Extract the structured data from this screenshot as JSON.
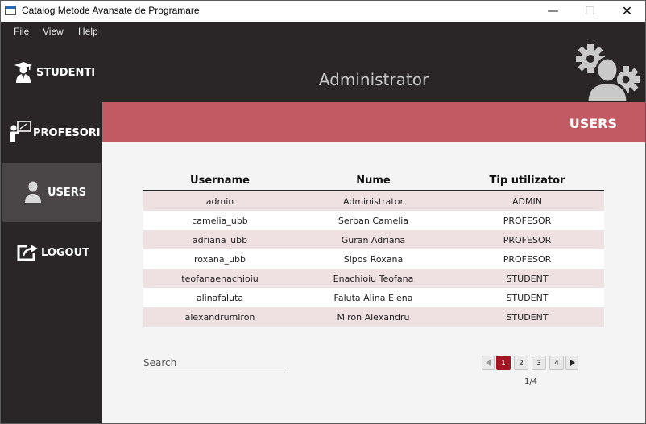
{
  "window": {
    "title": "Catalog Metode Avansate de Programare",
    "minimize_glyph": "—",
    "maximize_glyph": "☐",
    "close_glyph": "✕"
  },
  "menu": [
    "File",
    "View",
    "Help"
  ],
  "sidebar": {
    "items": [
      {
        "label": "STUDENTI",
        "icon": "graduate-icon"
      },
      {
        "label": "PROFESORI",
        "icon": "teacher-board-icon"
      },
      {
        "label": "USERS",
        "icon": "user-icon",
        "active": true
      },
      {
        "label": "LOGOUT",
        "icon": "logout-icon"
      }
    ]
  },
  "header": {
    "title": "Administrator",
    "icon": "admin-gear-user-icon"
  },
  "banner": {
    "title": "USERS"
  },
  "table": {
    "columns": [
      "Username",
      "Nume",
      "Tip utilizator"
    ],
    "rows": [
      [
        "admin",
        "Administrator",
        "ADMIN"
      ],
      [
        "camelia_ubb",
        "Serban Camelia",
        "PROFESOR"
      ],
      [
        "adriana_ubb",
        "Guran Adriana",
        "PROFESOR"
      ],
      [
        "roxana_ubb",
        "Sipos Roxana",
        "PROFESOR"
      ],
      [
        "teofanaenachioiu",
        "Enachioiu Teofana",
        "STUDENT"
      ],
      [
        "alinafaluta",
        "Faluta Alina Elena",
        "STUDENT"
      ],
      [
        "alexandrumiron",
        "Miron Alexandru",
        "STUDENT"
      ]
    ]
  },
  "search": {
    "placeholder": "Search",
    "value": ""
  },
  "pagination": {
    "pages": [
      "1",
      "2",
      "3",
      "4"
    ],
    "current": 1,
    "info": "1/4"
  },
  "colors": {
    "sidebar_bg": "#2a2628",
    "banner": "#c15a63",
    "active_page": "#a31522",
    "row_alt": "#efe0e2"
  }
}
